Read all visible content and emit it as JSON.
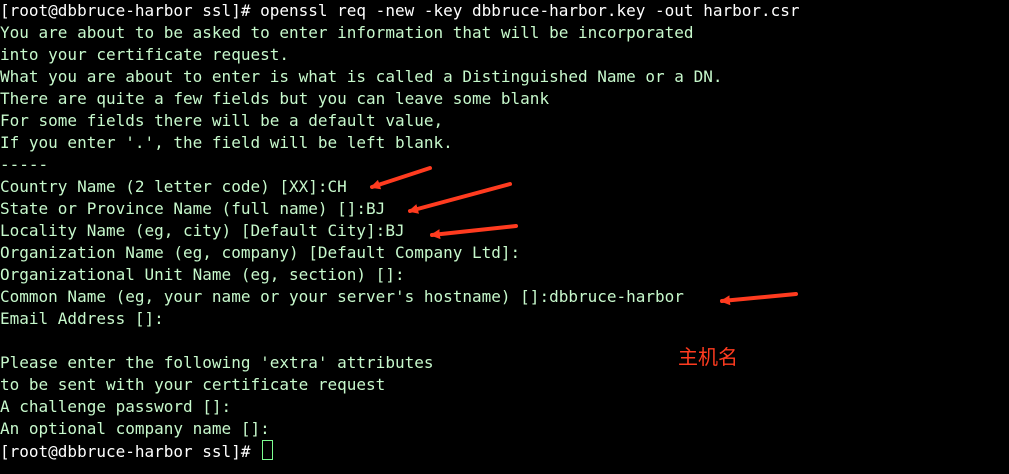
{
  "terminal": {
    "lines": [
      "[root@dbbruce-harbor ssl]# openssl req -new -key dbbruce-harbor.key -out harbor.csr",
      "You are about to be asked to enter information that will be incorporated",
      "into your certificate request.",
      "What you are about to enter is what is called a Distinguished Name or a DN.",
      "There are quite a few fields but you can leave some blank",
      "For some fields there will be a default value,",
      "If you enter '.', the field will be left blank.",
      "-----",
      "Country Name (2 letter code) [XX]:CH",
      "State or Province Name (full name) []:BJ",
      "Locality Name (eg, city) [Default City]:BJ",
      "Organization Name (eg, company) [Default Company Ltd]:",
      "Organizational Unit Name (eg, section) []:",
      "Common Name (eg, your name or your server's hostname) []:dbbruce-harbor",
      "Email Address []:",
      "",
      "Please enter the following 'extra' attributes",
      "to be sent with your certificate request",
      "A challenge password []:",
      "An optional company name []:",
      "[root@dbbruce-harbor ssl]# "
    ]
  },
  "annotation": {
    "note": "主机名",
    "color": "#ff3b1f"
  },
  "colors": {
    "background": "#000000",
    "output_text": "#c7f9cc",
    "prompt_text": "#ffffff",
    "cursor": "#7CFC90"
  }
}
